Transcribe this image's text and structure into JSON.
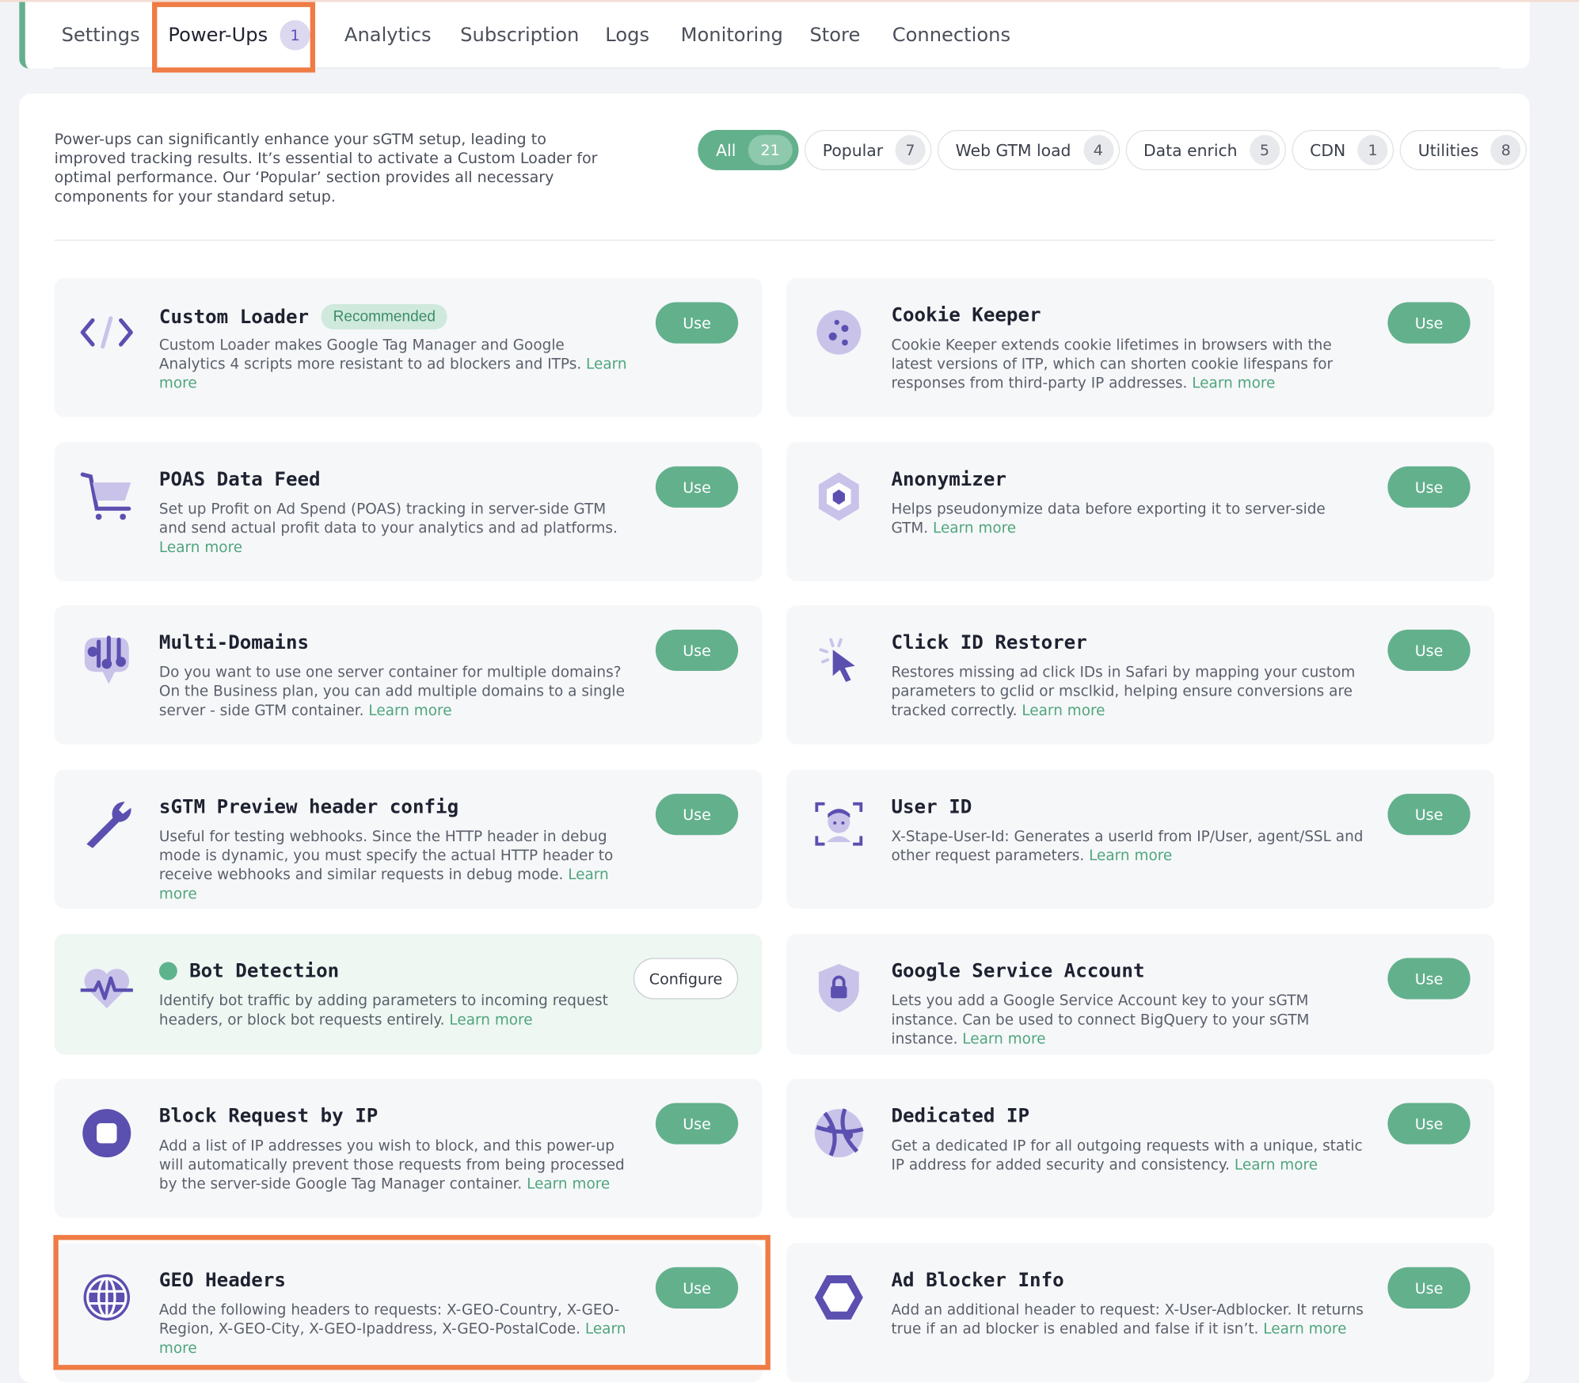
{
  "tabs": [
    {
      "label": "Settings"
    },
    {
      "label": "Power-Ups",
      "count": "1"
    },
    {
      "label": "Analytics"
    },
    {
      "label": "Subscription"
    },
    {
      "label": "Logs"
    },
    {
      "label": "Monitoring"
    },
    {
      "label": "Store"
    },
    {
      "label": "Connections"
    }
  ],
  "intro": "Power-ups can significantly enhance your sGTM setup, leading to improved tracking results. It’s essential to activate a Custom Loader for optimal performance. Our ‘Popular’ section provides all necessary components for your standard setup.",
  "filters": [
    {
      "label": "All",
      "count": "21"
    },
    {
      "label": "Popular",
      "count": "7"
    },
    {
      "label": "Web GTM load",
      "count": "4"
    },
    {
      "label": "Data enrich",
      "count": "5"
    },
    {
      "label": "CDN",
      "count": "1"
    },
    {
      "label": "Utilities",
      "count": "8"
    }
  ],
  "learn_more": "Learn more",
  "use_label": "Use",
  "configure_label": "Configure",
  "recommended_label": "Recommended",
  "cards": [
    {
      "title": "Custom Loader",
      "desc": "Custom Loader makes Google Tag Manager and Google Analytics 4 scripts more resistant to ad blockers and ITPs.",
      "icon": "code-icon"
    },
    {
      "title": "Cookie Keeper",
      "desc": "Cookie Keeper extends cookie lifetimes in browsers with the latest versions of ITP, which can shorten cookie lifespans for responses from third-party IP addresses.",
      "icon": "cookie-icon"
    },
    {
      "title": "POAS Data Feed",
      "desc": "Set up Profit on Ad Spend (POAS) tracking in server-side GTM and send actual profit data to your analytics and ad platforms.",
      "icon": "cart-icon"
    },
    {
      "title": "Anonymizer",
      "desc": "Helps pseudonymize data before exporting it to server-side GTM.",
      "icon": "hexagon-icon"
    },
    {
      "title": "Multi-Domains",
      "desc": "Do you want to use one server container for multiple domains? On the Business plan, you can add multiple domains to a single server - side GTM container.",
      "icon": "multi-domain-icon"
    },
    {
      "title": "Click ID Restorer",
      "desc": "Restores missing ad click IDs in Safari by mapping your custom parameters to gclid or msclkid, helping ensure conversions are tracked correctly.",
      "icon": "cursor-click-icon"
    },
    {
      "title": "sGTM Preview header config",
      "desc": "Useful for testing webhooks. Since the HTTP header in debug mode is dynamic, you must specify the actual HTTP header to receive webhooks and similar requests in debug mode.",
      "icon": "wrench-icon"
    },
    {
      "title": "User ID",
      "desc": "X-Stape-User-Id: Generates a userId from IP/User, agent/SSL and other request parameters.",
      "icon": "user-scan-icon"
    },
    {
      "title": "Bot Detection",
      "desc": "Identify bot traffic by adding parameters to incoming request headers, or block bot requests entirely.",
      "icon": "heartbeat-icon"
    },
    {
      "title": "Google Service Account",
      "desc": "Lets you add a Google Service Account key to your sGTM instance. Can be used to connect BigQuery to your sGTM instance.",
      "icon": "shield-lock-icon"
    },
    {
      "title": "Block Request by IP",
      "desc": "Add a list of IP addresses you wish to block, and this power-up will automatically prevent those requests from being processed by the server-side Google Tag Manager container.",
      "icon": "stop-icon"
    },
    {
      "title": "Dedicated IP",
      "desc": "Get a dedicated IP for all outgoing requests with a unique, static IP address for added security and consistency.",
      "icon": "network-globe-icon"
    },
    {
      "title": "GEO Headers",
      "desc": "Add the following headers to requests: X-GEO-Country, X-GEO-Region, X-GEO-City, X-GEO-Ipaddress, X-GEO-PostalCode.",
      "icon": "globe-icon"
    },
    {
      "title": "Ad Blocker Info",
      "desc": "Add an additional header to request: X-User-Adblocker. It returns true if an ad blocker is enabled and false if it isn’t.",
      "icon": "hexagon-outline-icon"
    }
  ],
  "colors": {
    "accent": "#63b08d",
    "icon": "#5b4fb0",
    "highlight": "#ef7b45"
  }
}
